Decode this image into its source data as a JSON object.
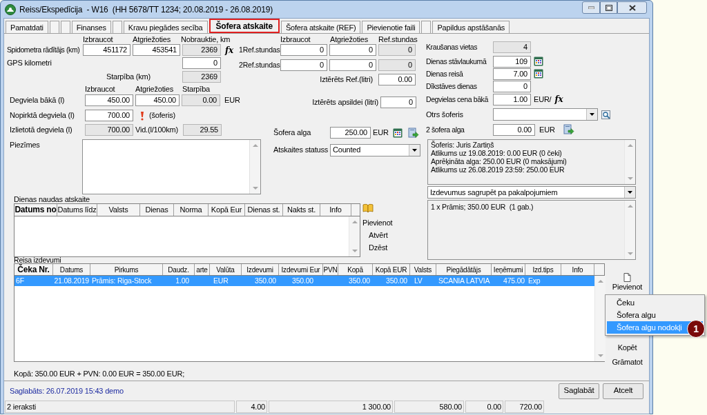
{
  "window": {
    "title": "Reiss/Ekspedīcija  - W16  (HH 5678/TT 1234; 20.08.2019 - 26.08.2019)"
  },
  "tabs": [
    {
      "label": "Pamatdati",
      "selected": false
    },
    {
      "selected": false
    },
    {
      "selected": false
    },
    {
      "label": "Finanses",
      "selected": false
    },
    {
      "selected": false
    },
    {
      "label": "Kravu piegādes secība",
      "selected": false
    },
    {
      "label": "Šofera atskaite",
      "selected": true
    },
    {
      "label": "Šofera atskaite (REF)",
      "selected": false
    },
    {
      "label": "Pievienotie faili",
      "selected": false
    },
    {
      "selected": false
    },
    {
      "label": "Papildus apstāšanās",
      "selected": false
    }
  ],
  "mileage": {
    "headers": [
      "Izbraucot",
      "Atgriežoties",
      "Nobrauktie, km"
    ],
    "odometer": {
      "label": "Spidometra rādītājs (km)",
      "start": "451172",
      "end": "453541",
      "driven": "2369",
      "formula": "fx"
    },
    "gps": {
      "label": "GPS kilometri",
      "value": "0"
    },
    "difference": {
      "label": "Starpība (km)",
      "value": "2369"
    }
  },
  "fuel": {
    "headers": [
      "Izbraucot",
      "Atgriežoties",
      "Starpība"
    ],
    "tank": {
      "label": "Degviela bākā (l)",
      "start": "450.00",
      "end": "450.00",
      "difference": "0.00",
      "unit": "EUR"
    },
    "purchased": {
      "label": "Nopirktā degviela (l)",
      "value": "700.00",
      "note": "(šoferis)"
    },
    "used": {
      "label": "Izlietotā degviela (l)",
      "value": "700.00",
      "average_label": "Vid.(l/100km)",
      "average": "29.55"
    }
  },
  "notes": {
    "label": "Piezīmes"
  },
  "refrigerator": {
    "headers": [
      "Izbraucot",
      "Atgriežoties",
      "Ref.stundas"
    ],
    "rows": [
      {
        "label": "1Ref.stundas",
        "start": "0",
        "end": "0",
        "hours": "0"
      },
      {
        "label": "2Ref.stundas",
        "start": "0",
        "end": "0",
        "hours": "0"
      }
    ],
    "spent": {
      "label": "Iztērēts Ref.(litri)",
      "value": "0.00"
    },
    "heating": {
      "label": "Iztērēts apsildei (litri)",
      "value": "0"
    }
  },
  "salary": {
    "label": "Šofera alga",
    "value": "250.00",
    "unit": "EUR"
  },
  "report_status": {
    "label": "Atskaites statuss",
    "value": "Counted"
  },
  "trip": {
    "loading_places": {
      "label": "Kraušanas vietas",
      "value": "4"
    },
    "parking_days": {
      "label": "Dienas stāvlaukumā",
      "value": "109"
    },
    "trip_days": {
      "label": "Dienas reisā",
      "value": "7.00"
    },
    "idle_days": {
      "label": "Dīkstāves dienas",
      "value": "0"
    },
    "fuel_price": {
      "label": "Degvielas cena bākā",
      "value": "1.00",
      "unit": "EUR/",
      "formula": "fx"
    },
    "second_driver": {
      "label": "Otrs šoferis"
    },
    "second_salary": {
      "label": "2 šofera alga",
      "value": "0.00",
      "unit": "EUR"
    }
  },
  "driver_summary": [
    "Šoferis: Juris Zartiņš",
    "Atlikums uz 19.08.2019: 0.00 EUR (0 čeki)",
    "Aprēķināta alga: 250.00 EUR (0 maksājumi)",
    "Atlikums uz 26.08.2019 23:59: 250.00 EUR"
  ],
  "grouping": {
    "value": "Izdevumus sagrupēt pa pakalpojumiem"
  },
  "grouped_expenses": [
    "1 x Prāmis; 350.00 EUR  (1 gab.)"
  ],
  "daily_allowance": {
    "title": "Dienas naudas atskaite",
    "columns": [
      "Datums no",
      "Datums līdz",
      "Valsts",
      "Dienas",
      "Norma",
      "Kopā Eur",
      "Dienas st.",
      "Nakts st.",
      "Info"
    ],
    "actions": [
      "Pievienot",
      "Atvērt",
      "Dzēst"
    ]
  },
  "expenses": {
    "title": "Reisa izdevumi",
    "columns": [
      "Čeka Nr.",
      "Datums",
      "Pirkums",
      "Daudz.",
      "arte",
      "Valūta",
      "Izdevumi",
      "Izdevumi Eur",
      "PVN",
      "Kopā",
      "Kopā EUR",
      "Valsts",
      "Piegādātājs",
      "Ieņēmumi",
      "Izd.tips",
      "Info"
    ],
    "rows": [
      {
        "selected": true,
        "cells": [
          "6F",
          "21.08.2019",
          "Prāmis: Riga-Stock",
          "1.00",
          "",
          "EUR",
          "350.00",
          "350.00",
          "",
          "350.00",
          "350.00",
          "LV",
          "SCANIA LATVIA",
          "475.00",
          "Exp",
          ""
        ]
      }
    ],
    "add_button": "Pievienot",
    "menu": [
      {
        "label": "Čeku",
        "selected": false
      },
      {
        "label": "Šofera algu",
        "selected": false
      },
      {
        "label": "Šofera algu nodokļi",
        "selected": true
      }
    ],
    "badge": "1",
    "actions": [
      "Kopēt",
      "Grāmatot"
    ],
    "total": "Kopā: 350.00 EUR + PVN: 0.00 EUR = 350.00 EUR;"
  },
  "saved_info": "Saglabāts: 26.07.2019 15:43 demo",
  "buttons": [
    "Saglabāt",
    "Atcelt"
  ],
  "status_bar": [
    "2 ieraksti",
    "4.00",
    "1 300.00",
    "580.00",
    "0.00",
    "720.00"
  ]
}
